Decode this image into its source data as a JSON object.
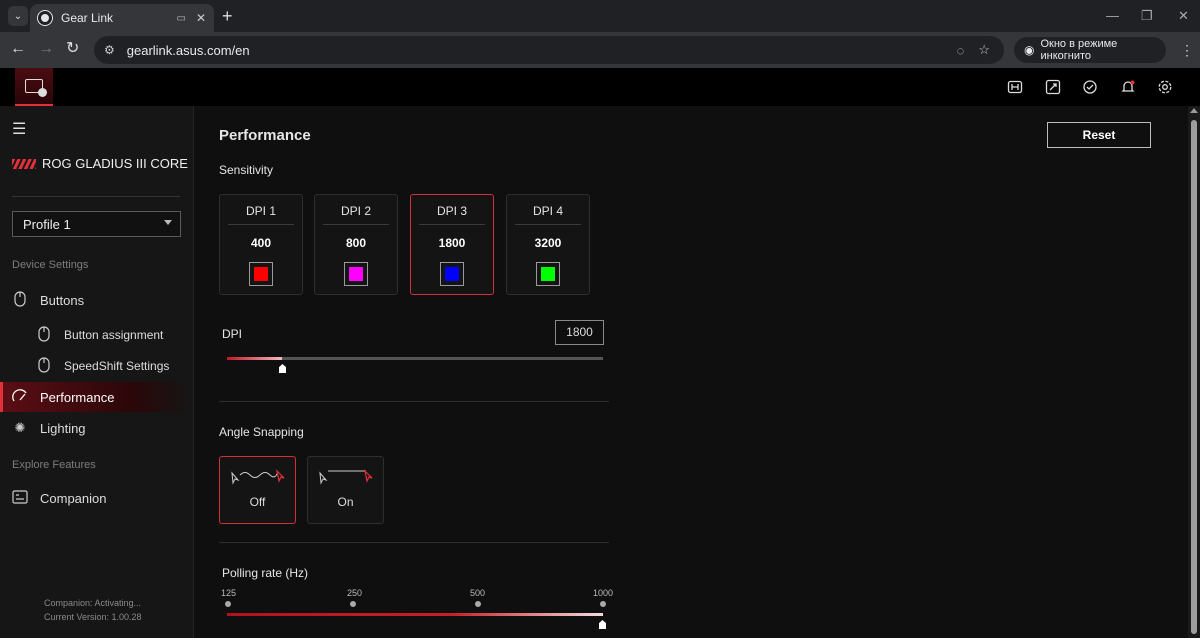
{
  "browser": {
    "tab_title": "Gear Link",
    "url": "gearlink.asus.com/en",
    "incognito_label": "Окно в режиме инкогнито"
  },
  "sidebar": {
    "device_name": "ROG GLADIUS III CORE",
    "profile": "Profile 1",
    "section_device": "Device Settings",
    "items": {
      "buttons": "Buttons",
      "button_assignment": "Button assignment",
      "speedshift": "SpeedShift Settings",
      "performance": "Performance",
      "lighting": "Lighting"
    },
    "section_explore": "Explore Features",
    "companion": "Companion",
    "footer_status": "Companion: Activating...",
    "footer_version": "Current Version: 1.00.28"
  },
  "main": {
    "title": "Performance",
    "reset_label": "Reset",
    "sensitivity_label": "Sensitivity",
    "dpi_stages": [
      {
        "name": "DPI 1",
        "value": "400",
        "color": "#ff0000"
      },
      {
        "name": "DPI 2",
        "value": "800",
        "color": "#ff00ff"
      },
      {
        "name": "DPI 3",
        "value": "1800",
        "color": "#0000ff"
      },
      {
        "name": "DPI 4",
        "value": "3200",
        "color": "#00ff00"
      }
    ],
    "selected_stage": "DPI 3",
    "dpi_label": "DPI",
    "dpi_value": "1800",
    "dpi_slider_fraction": 0.145,
    "angle_snapping_label": "Angle Snapping",
    "angle_off": "Off",
    "angle_on": "On",
    "angle_selected": "Off",
    "polling_label": "Polling rate (Hz)",
    "polling_points": [
      "125",
      "250",
      "500",
      "1000"
    ],
    "polling_selected": "1000"
  },
  "colors": {
    "accent": "#e0303a",
    "background": "#0f0f0f",
    "sidebar": "#161616"
  }
}
